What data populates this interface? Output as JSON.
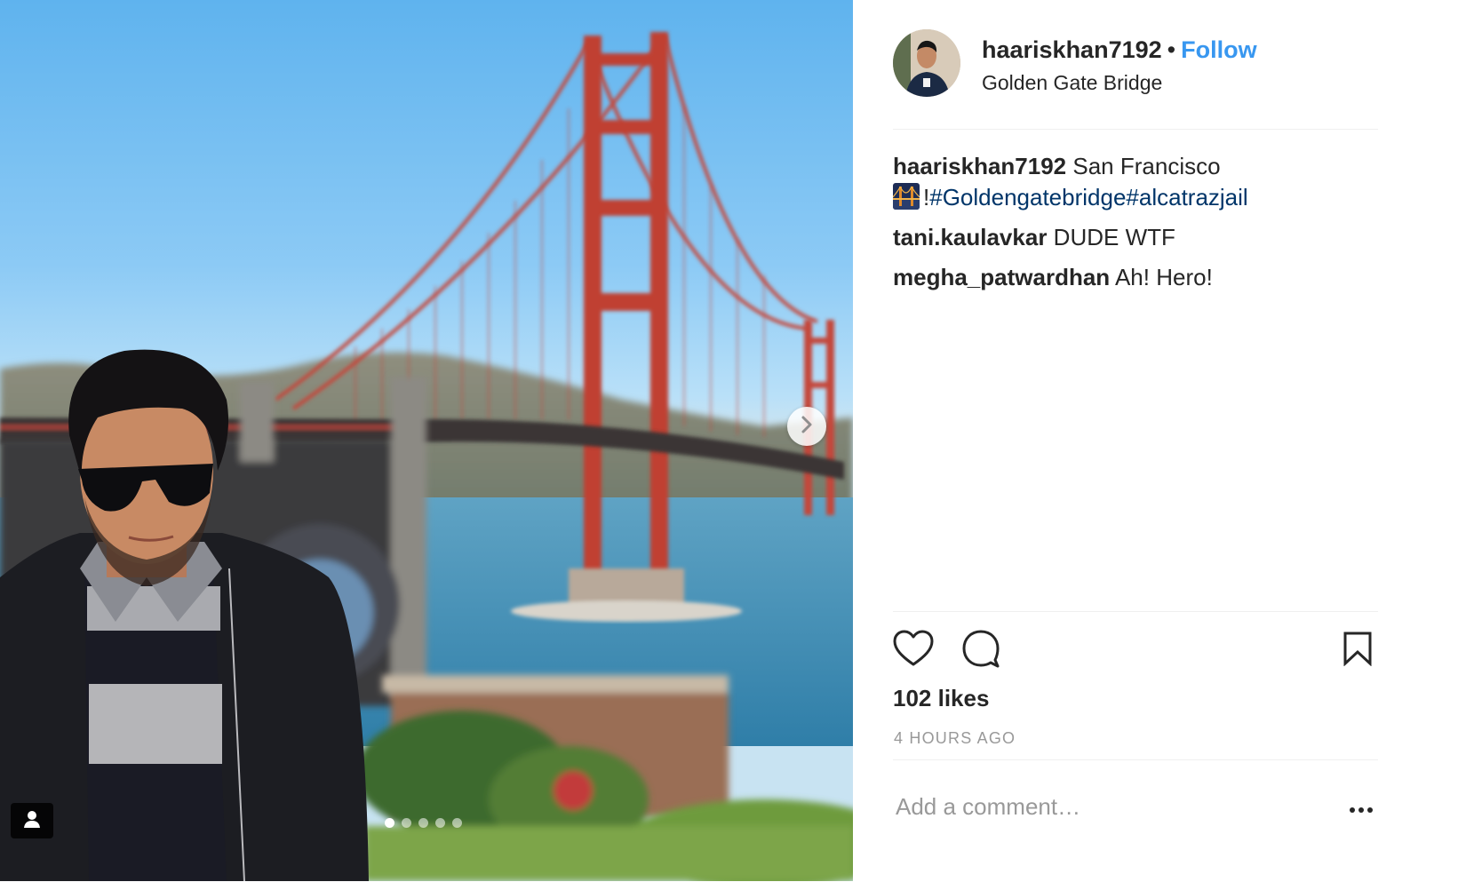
{
  "post": {
    "username": "haariskhan7192",
    "separator": "•",
    "follow_label": "Follow",
    "location": "Golden Gate Bridge",
    "photo": {
      "alt_scene": "golden-gate-bridge-selfie",
      "carousel_dots": 5,
      "active_dot": 0,
      "next_icon": "chevron-right-icon",
      "tag_icon": "user-tag-icon"
    }
  },
  "caption": {
    "username": "haariskhan7192",
    "text": "San Francisco",
    "text2": "!",
    "hashtags": "#Goldengatebridge#alcatrazjail"
  },
  "comments": [
    {
      "username": "tani.kaulavkar",
      "text": "DUDE WTF"
    },
    {
      "username": "megha_patwardhan",
      "text": "Ah! Hero!"
    }
  ],
  "actions": {
    "like_icon": "heart-icon",
    "comment_icon": "comment-bubble-icon",
    "save_icon": "bookmark-icon"
  },
  "likes": "102 likes",
  "timestamp": "4 HOURS AGO",
  "add_comment": {
    "placeholder": "Add a comment…",
    "more_icon": "ellipsis-icon"
  },
  "colors": {
    "link_blue": "#3897f0",
    "hashtag": "#003569",
    "text": "#262626",
    "muted": "#999999",
    "divider": "#efefef"
  }
}
